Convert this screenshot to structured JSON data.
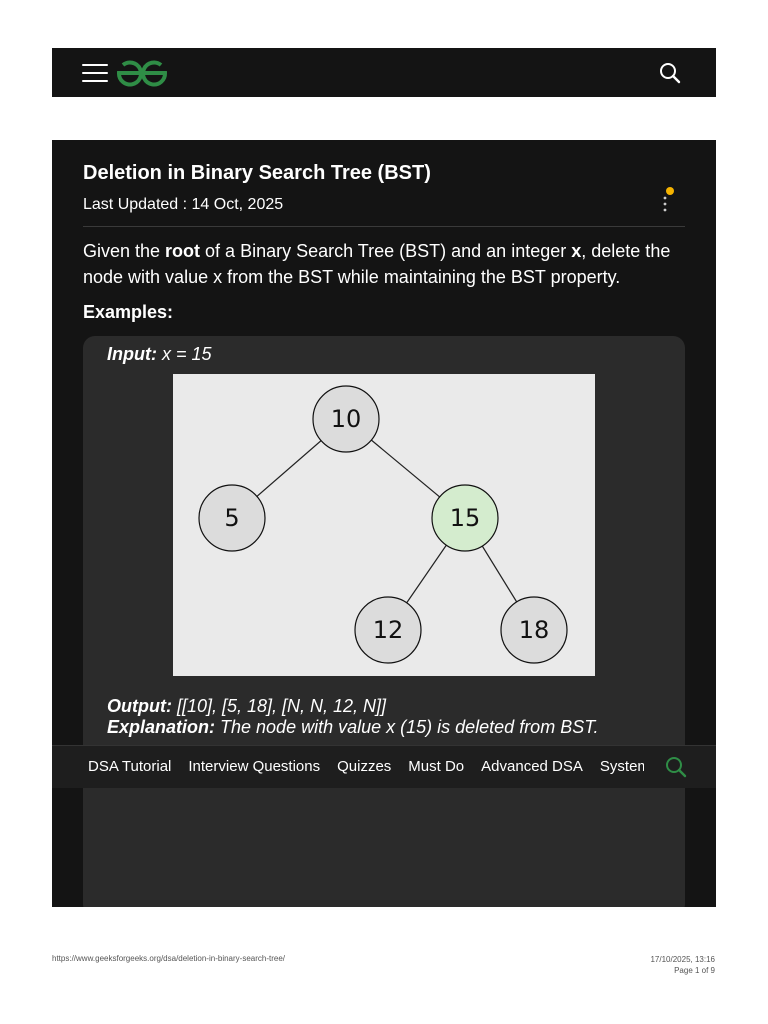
{
  "article": {
    "title": "Deletion in Binary Search Tree (BST)",
    "updated": "Last Updated : 14 Oct, 2025",
    "para": {
      "t1": "Given the ",
      "b1": "root",
      "t2": " of a Binary Search Tree (BST) and an integer ",
      "b2": "x",
      "t3": ", delete the node with value x from the BST while maintaining the BST property."
    },
    "examples_heading": "Examples:"
  },
  "example": {
    "input_label": "Input:",
    "input_value": " x = 15",
    "tree": {
      "nodes": [
        "10",
        "5",
        "15",
        "12",
        "18"
      ],
      "highlighted": "15",
      "node_fill": "#dcdcdc",
      "highlight_fill": "#d4ecce"
    },
    "output_label": "Output:",
    "output_value": " [[10], [5, 18], [N, N, 12, N]]",
    "explanation_label": "Explanation:",
    "explanation_value": "  The node with value x (15) is deleted from BST."
  },
  "navbar": {
    "items": [
      "DSA Tutorial",
      "Interview Questions",
      "Quizzes",
      "Must Do",
      "Advanced DSA",
      "System Design"
    ]
  },
  "icons": {
    "menu": "hamburger-menu-icon",
    "logo": "geeksforgeeks-logo",
    "search": "search-icon",
    "more": "more-options-icon"
  },
  "colors": {
    "brand_green": "#2f8d46",
    "notification_dot": "#f5b300",
    "nav_search": "#2f8d46"
  },
  "footer": {
    "url": "https://www.geeksforgeeks.org/dsa/deletion-in-binary-search-tree/",
    "datetime": "17/10/2025, 13:16",
    "page": "Page 1 of 9"
  }
}
